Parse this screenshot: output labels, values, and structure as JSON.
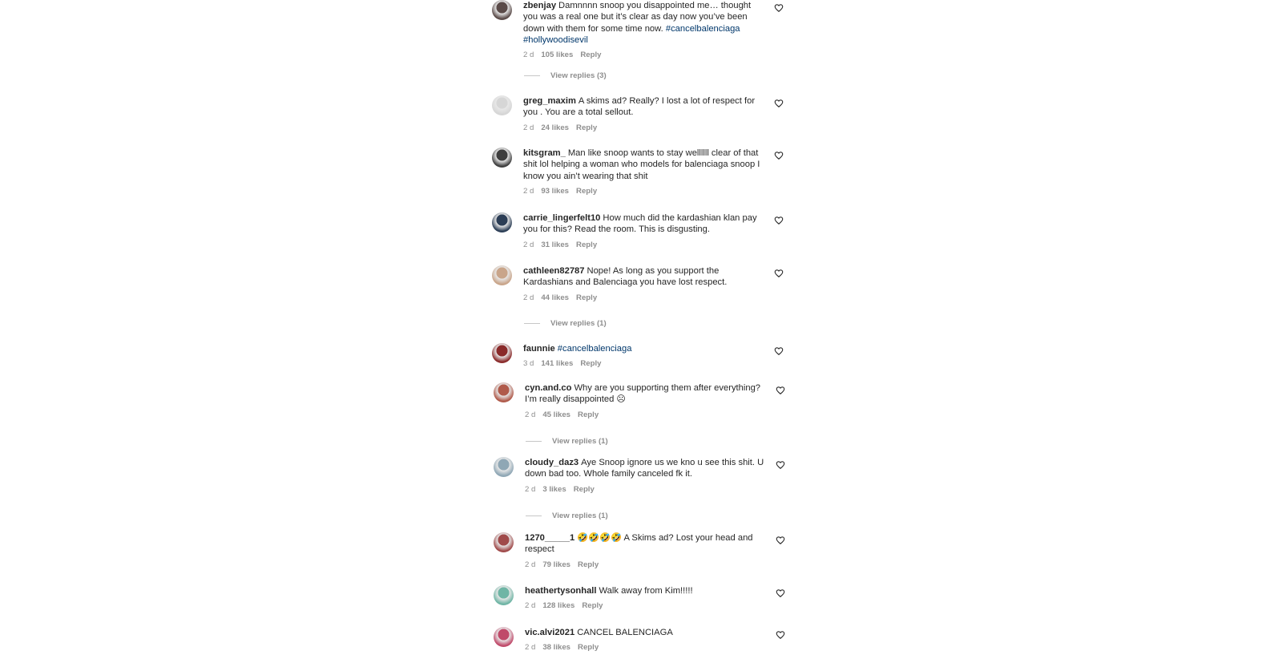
{
  "comments": [
    {
      "user": "zbenjay",
      "parts": [
        {
          "t": "Damnnnn snoop you disappointed me… thought you was a real one but it’s clear as day now you’ve been down with them for some time now. "
        },
        {
          "t": "#cancelbalenciaga",
          "tag": true
        },
        {
          "t": " "
        },
        {
          "t": "#hollywoodisevil",
          "tag": true
        }
      ],
      "time": "2 d",
      "likes": "105 likes",
      "reply": "Reply",
      "view_replies": "View replies (3)"
    },
    {
      "user": "greg_maxim",
      "parts": [
        {
          "t": "A skims ad? Really? I lost a lot of respect for you . You are a total sellout."
        }
      ],
      "time": "2 d",
      "likes": "24 likes",
      "reply": "Reply"
    },
    {
      "user": "kitsgram_",
      "parts": [
        {
          "t": "Man like snoop wants to stay wellllll clear of that shit lol helping a woman who models for balenciaga snoop I know you ain’t wearing that shit"
        }
      ],
      "time": "2 d",
      "likes": "93 likes",
      "reply": "Reply"
    },
    {
      "user": "carrie_lingerfelt10",
      "parts": [
        {
          "t": "How much did the kardashian klan pay you for this? Read the room. This is disgusting."
        }
      ],
      "time": "2 d",
      "likes": "31 likes",
      "reply": "Reply"
    },
    {
      "user": "cathleen82787",
      "parts": [
        {
          "t": "Nope! As long as you support the Kardashians and Balenciaga you have lost respect."
        }
      ],
      "time": "2 d",
      "likes": "44 likes",
      "reply": "Reply",
      "view_replies": "View replies (1)"
    },
    {
      "user": "faunnie",
      "parts": [
        {
          "t": "#cancelbalenciaga",
          "tag": true
        }
      ],
      "time": "3 d",
      "likes": "141 likes",
      "reply": "Reply"
    },
    {
      "user": "cyn.and.co",
      "parts": [
        {
          "t": "Why are you supporting them after everything? I’m really disappointed ☹"
        }
      ],
      "time": "2 d",
      "likes": "45 likes",
      "reply": "Reply",
      "view_replies": "View replies (1)"
    },
    {
      "user": "cloudy_daz3",
      "parts": [
        {
          "t": "Aye Snoop ignore us we kno u see this shit. U down bad too. Whole family canceled fk it."
        }
      ],
      "time": "2 d",
      "likes": "3 likes",
      "reply": "Reply",
      "view_replies": "View replies (1)"
    },
    {
      "user": "1270_____1",
      "parts": [
        {
          "t": "🤣🤣🤣🤣 A Skims ad? Lost your head and respect"
        }
      ],
      "time": "2 d",
      "likes": "79 likes",
      "reply": "Reply"
    },
    {
      "user": "heathertysonhall",
      "parts": [
        {
          "t": "Walk away from Kim!!!!!"
        }
      ],
      "time": "2 d",
      "likes": "128 likes",
      "reply": "Reply"
    },
    {
      "user": "vic.alvi2021",
      "parts": [
        {
          "t": "CANCEL BALENCIAGA"
        }
      ],
      "time": "2 d",
      "likes": "38 likes",
      "reply": "Reply"
    }
  ],
  "colors": {
    "text": "#262626",
    "muted": "#8e8e8e",
    "hashtag": "#00376b"
  },
  "avatar_colors": [
    "#5a4a48",
    "#d6d6d6",
    "#3e3e3e",
    "#2b3d55",
    "#c9a58a",
    "#8a2a2a",
    "#b05a4a",
    "#8fa7b5",
    "#a04a4a",
    "#6fb5a5",
    "#c04a6a"
  ],
  "icons": {
    "like": "heart-outline-icon"
  }
}
